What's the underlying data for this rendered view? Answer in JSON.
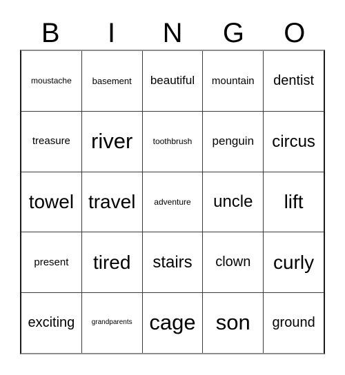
{
  "card": {
    "title": "BINGO",
    "columns": [
      "B",
      "I",
      "N",
      "G",
      "O"
    ],
    "rows": [
      {
        "cells": [
          {
            "word": "moustache",
            "size": "sz-xs"
          },
          {
            "word": "basement",
            "size": "sz-s"
          },
          {
            "word": "beautiful",
            "size": "sz-l"
          },
          {
            "word": "mountain",
            "size": "sz-m"
          },
          {
            "word": "dentist",
            "size": "sz-xl"
          }
        ]
      },
      {
        "cells": [
          {
            "word": "treasure",
            "size": "sz-m"
          },
          {
            "word": "river",
            "size": "sz-hh"
          },
          {
            "word": "toothbrush",
            "size": "sz-xs"
          },
          {
            "word": "penguin",
            "size": "sz-l"
          },
          {
            "word": "circus",
            "size": "sz-xxl"
          }
        ]
      },
      {
        "cells": [
          {
            "word": "towel",
            "size": "sz-h"
          },
          {
            "word": "travel",
            "size": "sz-h"
          },
          {
            "word": "adventure",
            "size": "sz-xs"
          },
          {
            "word": "uncle",
            "size": "sz-xxl"
          },
          {
            "word": "lift",
            "size": "sz-h"
          }
        ]
      },
      {
        "cells": [
          {
            "word": "present",
            "size": "sz-m"
          },
          {
            "word": "tired",
            "size": "sz-h"
          },
          {
            "word": "stairs",
            "size": "sz-xxl"
          },
          {
            "word": "clown",
            "size": "sz-xl"
          },
          {
            "word": "curly",
            "size": "sz-h"
          }
        ]
      },
      {
        "cells": [
          {
            "word": "exciting",
            "size": "sz-xl"
          },
          {
            "word": "grandparents",
            "size": "sz-xxs"
          },
          {
            "word": "cage",
            "size": "sz-hh"
          },
          {
            "word": "son",
            "size": "sz-hh"
          },
          {
            "word": "ground",
            "size": "sz-xl"
          }
        ]
      }
    ]
  },
  "style": {
    "background_color": "#ffffff",
    "text_color": "#000000",
    "grid_line_color": "#3a3a3a",
    "outer_border_color": "#1a1a1a"
  }
}
